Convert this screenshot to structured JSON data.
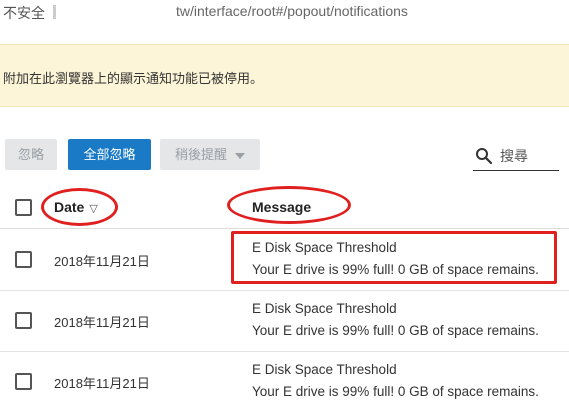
{
  "address_bar": {
    "security_label": "不安全",
    "url_text": "tw/interface/root#/popout/notifications"
  },
  "banner": {
    "message": "附加在此瀏覽器上的顯示通知功能已被停用。"
  },
  "toolbar": {
    "ignore_label": "忽略",
    "ignore_all_label": "全部忽略",
    "remind_later_label": "稍後提醒",
    "search_label": "搜尋"
  },
  "table": {
    "columns": {
      "date": "Date",
      "message": "Message"
    },
    "rows": [
      {
        "date": "2018年11月21日",
        "title": "E Disk Space Threshold",
        "body": "Your E drive is 99% full! 0 GB of space remains."
      },
      {
        "date": "2018年11月21日",
        "title": "E Disk Space Threshold",
        "body": "Your E drive is 99% full! 0 GB of space remains."
      },
      {
        "date": "2018年11月21日",
        "title": "E Disk Space Threshold",
        "body": "Your E drive is 99% full! 0 GB of space remains."
      }
    ]
  },
  "colors": {
    "primary_button": "#1a7ac6",
    "banner_background": "#fdf5d7",
    "annotation": "#e0201f"
  },
  "icons": {
    "search": "search-icon",
    "sort": "sort-down-icon",
    "dropdown": "chevron-down-icon"
  }
}
